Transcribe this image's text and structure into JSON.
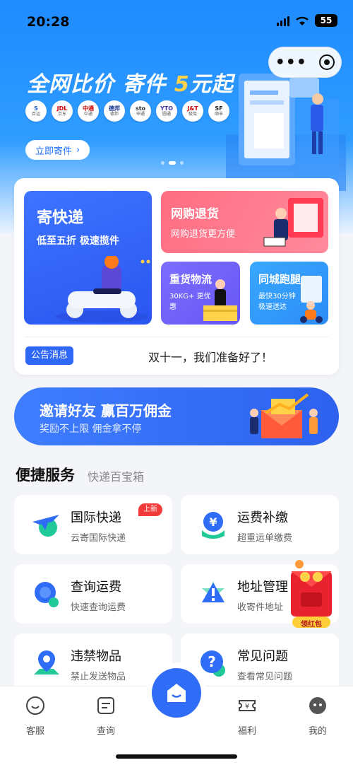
{
  "status_bar": {
    "time": "20:28",
    "battery": "55"
  },
  "hero": {
    "title_pre": "全网比价 寄件 ",
    "title_accent": "5",
    "title_post": "元起",
    "carriers": [
      {
        "logo": "S",
        "sub": "百运"
      },
      {
        "logo": "JDL",
        "sub": "京东"
      },
      {
        "logo": "中通",
        "sub": "中通"
      },
      {
        "logo": "德邦",
        "sub": "德邦"
      },
      {
        "logo": "sto",
        "sub": "申通"
      },
      {
        "logo": "YTO",
        "sub": "圆通"
      },
      {
        "logo": "J&T",
        "sub": "极兔"
      },
      {
        "logo": "SF",
        "sub": "顺丰"
      }
    ],
    "cta_label": "立即寄件",
    "cta_chevron": "›"
  },
  "mini_capsule": {
    "menu_glyph": "•••"
  },
  "main_card": {
    "send": {
      "title": "寄快递",
      "subtitle": "低至五折 极速揽件"
    },
    "return": {
      "title": "网购退货",
      "subtitle": "网购退货更方便"
    },
    "freight": {
      "title": "重货物流",
      "subtitle": "30KG+ 更优惠"
    },
    "local": {
      "title": "同城跑腿",
      "subtitle": "最快30分钟 极速送达"
    },
    "notice_tag": "公告消息",
    "notice_text": "双十一，我们准备好了！"
  },
  "invite": {
    "title": "邀请好友 赢百万佣金",
    "subtitle": "奖励不上限 佣金拿不停"
  },
  "quick_services": {
    "title": "便捷服务",
    "subtitle": "快递百宝箱",
    "items": [
      {
        "title": "国际快递",
        "subtitle": "云寄国际快递",
        "badge": "上新",
        "icon": "plane-icon"
      },
      {
        "title": "运费补缴",
        "subtitle": "超重运单缴费",
        "icon": "yen-shield-icon"
      },
      {
        "title": "查询运费",
        "subtitle": "快速查询运费",
        "icon": "magnifier-icon"
      },
      {
        "title": "地址管理",
        "subtitle": "收寄件地址",
        "icon": "warning-star-icon"
      },
      {
        "title": "违禁物品",
        "subtitle": "禁止发送物品",
        "icon": "location-pin-icon"
      },
      {
        "title": "常见问题",
        "subtitle": "查看常见问题",
        "icon": "question-icon"
      }
    ],
    "red_packet_label": "领红包"
  },
  "tabbar": {
    "items": [
      {
        "label": "客服",
        "icon": "customer-service-icon"
      },
      {
        "label": "查询",
        "icon": "search-doc-icon"
      },
      {
        "label": "",
        "icon": "home-icon"
      },
      {
        "label": "福利",
        "icon": "ticket-icon"
      },
      {
        "label": "我的",
        "icon": "profile-icon"
      }
    ]
  },
  "colors": {
    "primary": "#2f6df6",
    "accent_yellow": "#ffd24a",
    "badge_red": "#f33a3a"
  }
}
